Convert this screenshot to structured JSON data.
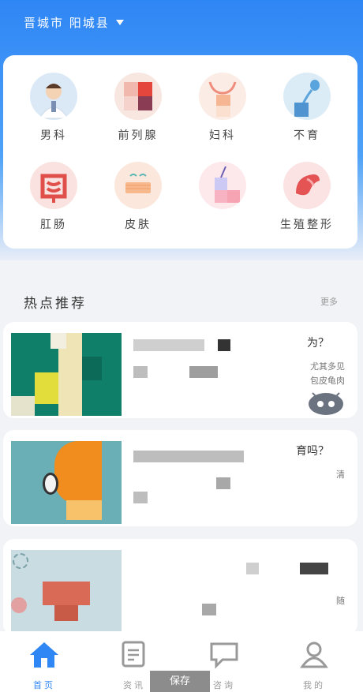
{
  "header": {
    "location": "晋城市 阳城县"
  },
  "categories": [
    {
      "label": "男科",
      "icon": "male-doctor-icon"
    },
    {
      "label": "前列腺",
      "icon": "prostate-icon"
    },
    {
      "label": "妇科",
      "icon": "gynecology-icon"
    },
    {
      "label": "不育",
      "icon": "infertility-icon"
    },
    {
      "label": "肛肠",
      "icon": "intestine-icon"
    },
    {
      "label": "皮肤",
      "icon": "skin-icon"
    },
    {
      "label": "",
      "icon": "injection-icon"
    },
    {
      "label": "生殖整形",
      "icon": "reproductive-plastic-icon"
    }
  ],
  "hot": {
    "title": "热点推荐",
    "more": "更多"
  },
  "articles": [
    {
      "title_visible": "为？",
      "desc_visible": "尤其多见\n包皮龟肉"
    },
    {
      "title_visible": "育吗？",
      "desc_visible": "清"
    },
    {
      "title_visible": "",
      "desc_visible": "随"
    }
  ],
  "tabbar": {
    "items": [
      {
        "label": "首页",
        "icon": "home-icon",
        "active": true
      },
      {
        "label": "资讯",
        "icon": "news-icon",
        "active": false
      },
      {
        "label": "咨询",
        "icon": "chat-icon",
        "active": false
      },
      {
        "label": "我的",
        "icon": "user-icon",
        "active": false
      }
    ]
  },
  "overlay": {
    "save_label": "保存"
  },
  "colors": {
    "primary": "#2f86f5",
    "tab_inactive": "#999999"
  }
}
